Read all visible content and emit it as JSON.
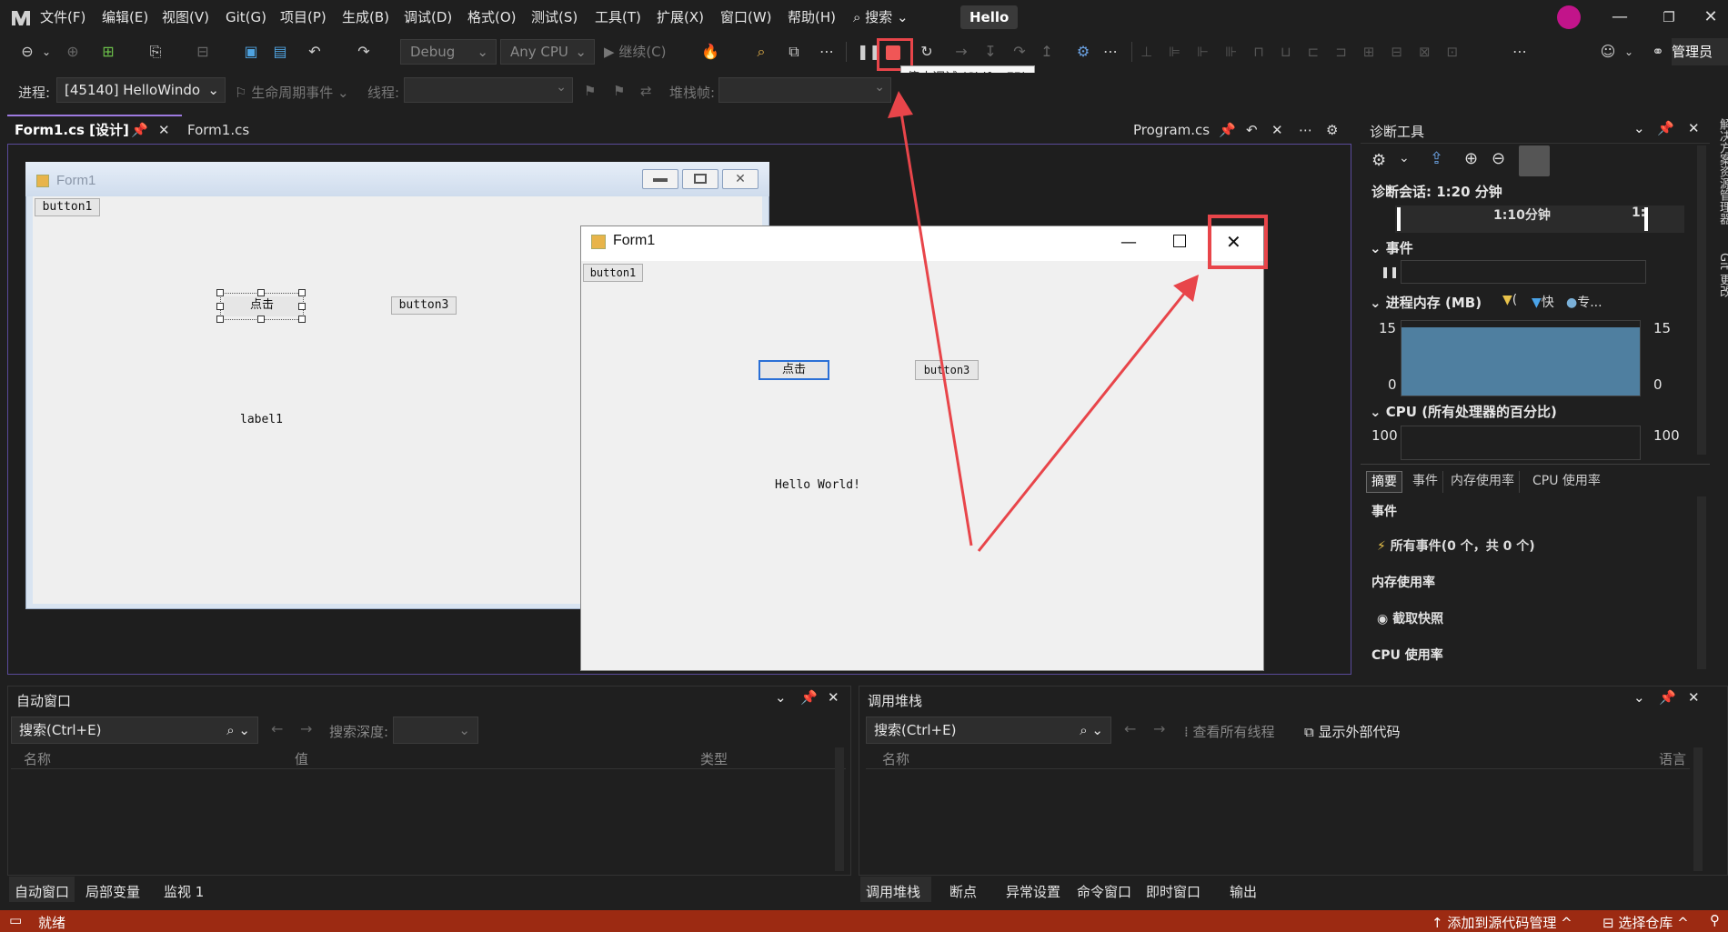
{
  "menubar": {
    "items": [
      "文件(F)",
      "编辑(E)",
      "视图(V)",
      "Git(G)",
      "项目(P)",
      "生成(B)",
      "调试(D)",
      "格式(O)",
      "测试(S)",
      "工具(T)",
      "扩展(X)",
      "窗口(W)",
      "帮助(H)"
    ],
    "search_label": "搜索",
    "solution_name": "Hello"
  },
  "toolbar": {
    "config": "Debug",
    "platform": "Any CPU",
    "continue_label": "继续(C)",
    "stop_tooltip": "停止调试 (Shift+F5)",
    "admin_label": "管理员"
  },
  "debugbar": {
    "process_label": "进程:",
    "process_value": "[45140] HelloWindo",
    "lifecycle_label": "生命周期事件",
    "thread_label": "线程:",
    "stackframe_label": "堆栈帧:"
  },
  "tabs": {
    "active": "Form1.cs [设计]",
    "second": "Form1.cs",
    "right": "Program.cs"
  },
  "designer_form": {
    "title": "Form1",
    "button1": "button1",
    "button2": "点击",
    "button3": "button3",
    "label1": "label1"
  },
  "running_form": {
    "title": "Form1",
    "button1": "button1",
    "button2": "点击",
    "button3": "button3",
    "label": "Hello World!"
  },
  "diagnostics": {
    "title": "诊断工具",
    "session": "诊断会话: 1:20 分钟",
    "timeline_label": "1:10分钟",
    "timeline_label2": "1:",
    "events_section": "事件",
    "memory_section": "进程内存 (MB)",
    "memory_legend": [
      "(",
      "快",
      "专..."
    ],
    "memory_ymax": "15",
    "memory_ymin": "0",
    "memory_level": 0.92,
    "cpu_section": "CPU (所有处理器的百分比)",
    "cpu_ymax": "100",
    "subtabs": [
      "摘要",
      "事件",
      "内存使用率",
      "CPU 使用率"
    ],
    "summary_events": "事件",
    "all_events": "所有事件(0 个，共 0 个)",
    "memory_usage": "内存使用率",
    "snapshot": "截取快照",
    "cpu_usage": "CPU 使用率"
  },
  "sidebar_right": [
    "解决方案资源管理器",
    "Git 更改"
  ],
  "autos": {
    "title": "自动窗口",
    "search": "搜索(Ctrl+E)",
    "depth_label": "搜索深度:",
    "columns": [
      "名称",
      "值",
      "类型"
    ],
    "tabs": [
      "自动窗口",
      "局部变量",
      "监视 1"
    ]
  },
  "callstack": {
    "title": "调用堆栈",
    "search": "搜索(Ctrl+E)",
    "view_threads": "查看所有线程",
    "show_external": "显示外部代码",
    "columns": [
      "名称",
      "语言"
    ],
    "tabs": [
      "调用堆栈",
      "断点",
      "异常设置",
      "命令窗口",
      "即时窗口",
      "输出"
    ]
  },
  "status": {
    "ready": "就绪",
    "add_source": "添加到源代码管理",
    "select_repo": "选择仓库"
  },
  "colors": {
    "highlight": "#e8454a",
    "accent": "#9d7ae0",
    "statusbar": "#9c2a12"
  }
}
